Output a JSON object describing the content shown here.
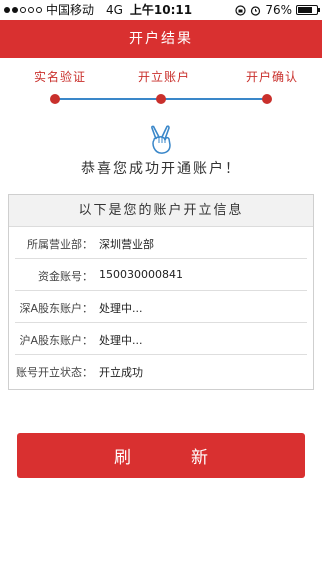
{
  "status_bar": {
    "carrier": "中国移动",
    "network": "4G",
    "time": "上午10:11",
    "battery": "76%",
    "battery_level": 0.76
  },
  "navbar": {
    "title": "开户结果"
  },
  "steps": [
    "实名验证",
    "开立账户",
    "开户确认"
  ],
  "congrats": "恭喜您成功开通账户！",
  "info": {
    "title": "以下是您的账户开立信息",
    "rows": [
      {
        "label": "所属营业部：",
        "value": "深圳营业部"
      },
      {
        "label": "资金账号：",
        "value": "150030000841"
      },
      {
        "label": "深A股东账户：",
        "value": "处理中..."
      },
      {
        "label": "沪A股东账户：",
        "value": "处理中..."
      },
      {
        "label": "账号开立状态：",
        "value": "开立成功"
      }
    ]
  },
  "refresh_button": "刷新",
  "colors": {
    "brand_red": "#d93030",
    "progress_blue": "#3a87c9"
  }
}
